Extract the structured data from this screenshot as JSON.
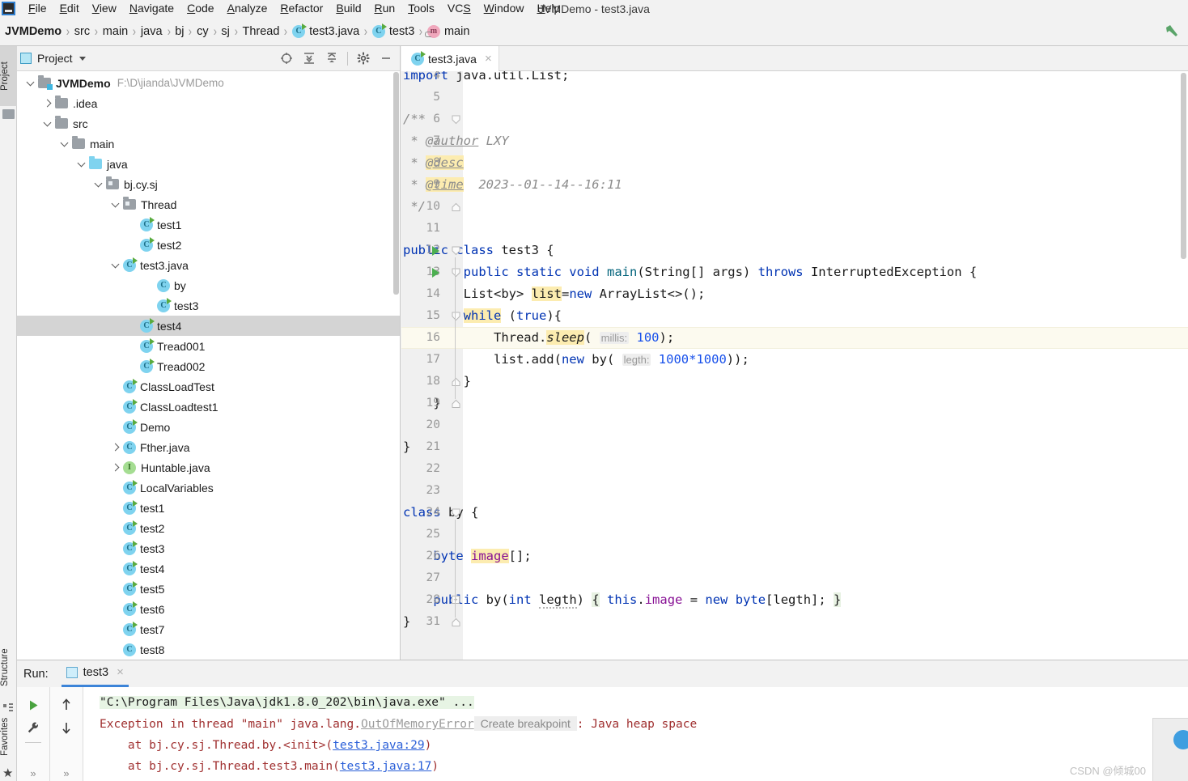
{
  "window": {
    "title": "JVMDemo - test3.java"
  },
  "menubar": {
    "logo_icon": "intellij-logo-icon",
    "items": [
      {
        "label": "File",
        "mnemonic": "F"
      },
      {
        "label": "Edit",
        "mnemonic": "E"
      },
      {
        "label": "View",
        "mnemonic": "V"
      },
      {
        "label": "Navigate",
        "mnemonic": "N"
      },
      {
        "label": "Code",
        "mnemonic": "C"
      },
      {
        "label": "Analyze",
        "mnemonic": "A"
      },
      {
        "label": "Refactor",
        "mnemonic": "R"
      },
      {
        "label": "Build",
        "mnemonic": "B"
      },
      {
        "label": "Run",
        "mnemonic": "R"
      },
      {
        "label": "Tools",
        "mnemonic": "T"
      },
      {
        "label": "VCS",
        "mnemonic": "S"
      },
      {
        "label": "Window",
        "mnemonic": "W"
      },
      {
        "label": "Help",
        "mnemonic": "H"
      }
    ]
  },
  "breadcrumb": {
    "items": [
      {
        "label": "JVMDemo",
        "icon": "none",
        "bold": true
      },
      {
        "label": "src",
        "icon": "none",
        "bold": false
      },
      {
        "label": "main",
        "icon": "none",
        "bold": false
      },
      {
        "label": "java",
        "icon": "none",
        "bold": false
      },
      {
        "label": "bj",
        "icon": "none",
        "bold": false
      },
      {
        "label": "cy",
        "icon": "none",
        "bold": false
      },
      {
        "label": "sj",
        "icon": "none",
        "bold": false
      },
      {
        "label": "Thread",
        "icon": "none",
        "bold": false
      },
      {
        "label": "test3.java",
        "icon": "class-runnable-icon",
        "bold": false
      },
      {
        "label": "test3",
        "icon": "class-runnable-icon",
        "bold": false
      },
      {
        "label": "main",
        "icon": "method-icon",
        "bold": false
      }
    ],
    "build_icon": "hammer-icon"
  },
  "left_strip": {
    "tabs": [
      {
        "label": "Project",
        "icon": "project-icon",
        "active": true
      },
      {
        "label": "Structure",
        "icon": "structure-icon",
        "active": false
      },
      {
        "label": "Favorites",
        "icon": "star-icon",
        "active": false
      }
    ]
  },
  "project_panel": {
    "title": "Project",
    "title_icon": "project-view-icon",
    "toolbar": [
      {
        "name": "select-opened-file-icon",
        "glyph": "target"
      },
      {
        "name": "expand-all-icon",
        "glyph": "expand"
      },
      {
        "name": "collapse-all-icon",
        "glyph": "collapse"
      },
      {
        "name": "settings-icon",
        "glyph": "gear"
      },
      {
        "name": "hide-icon",
        "glyph": "minus"
      }
    ],
    "tree": [
      {
        "indent": 0,
        "twisty": "down",
        "icon": "folder-module",
        "label": "JVMDemo",
        "bold": true,
        "path": "F:\\D\\jianda\\JVMDemo",
        "selected": false
      },
      {
        "indent": 1,
        "twisty": "right",
        "icon": "folder",
        "label": ".idea",
        "bold": false,
        "selected": false
      },
      {
        "indent": 1,
        "twisty": "down",
        "icon": "folder",
        "label": "src",
        "bold": false,
        "selected": false
      },
      {
        "indent": 2,
        "twisty": "down",
        "icon": "folder",
        "label": "main",
        "bold": false,
        "selected": false
      },
      {
        "indent": 3,
        "twisty": "down",
        "icon": "folder-source",
        "label": "java",
        "bold": false,
        "selected": false
      },
      {
        "indent": 4,
        "twisty": "down",
        "icon": "folder-package",
        "label": "bj.cy.sj",
        "bold": false,
        "selected": false
      },
      {
        "indent": 5,
        "twisty": "down",
        "icon": "folder-package",
        "label": "Thread",
        "bold": false,
        "selected": false
      },
      {
        "indent": 6,
        "twisty": "none",
        "icon": "class-runnable",
        "label": "test1",
        "bold": false,
        "selected": false
      },
      {
        "indent": 6,
        "twisty": "none",
        "icon": "class-runnable",
        "label": "test2",
        "bold": false,
        "selected": false
      },
      {
        "indent": 5,
        "twisty": "down",
        "icon": "class-runnable",
        "label": "test3.java",
        "bold": false,
        "selected": false
      },
      {
        "indent": 7,
        "twisty": "none",
        "icon": "class",
        "label": "by",
        "bold": false,
        "selected": false
      },
      {
        "indent": 7,
        "twisty": "none",
        "icon": "class-runnable",
        "label": "test3",
        "bold": false,
        "selected": false
      },
      {
        "indent": 6,
        "twisty": "none",
        "icon": "class-runnable",
        "label": "test4",
        "bold": false,
        "selected": true
      },
      {
        "indent": 6,
        "twisty": "none",
        "icon": "class-runnable",
        "label": "Tread001",
        "bold": false,
        "selected": false
      },
      {
        "indent": 6,
        "twisty": "none",
        "icon": "class-runnable",
        "label": "Tread002",
        "bold": false,
        "selected": false
      },
      {
        "indent": 5,
        "twisty": "none",
        "icon": "class-runnable",
        "label": "ClassLoadTest",
        "bold": false,
        "selected": false
      },
      {
        "indent": 5,
        "twisty": "none",
        "icon": "class-runnable",
        "label": "ClassLoadtest1",
        "bold": false,
        "selected": false
      },
      {
        "indent": 5,
        "twisty": "none",
        "icon": "class-runnable",
        "label": "Demo",
        "bold": false,
        "selected": false
      },
      {
        "indent": 5,
        "twisty": "right",
        "icon": "class",
        "label": "Fther.java",
        "bold": false,
        "selected": false
      },
      {
        "indent": 5,
        "twisty": "right",
        "icon": "interface",
        "label": "Huntable.java",
        "bold": false,
        "selected": false
      },
      {
        "indent": 5,
        "twisty": "none",
        "icon": "class-runnable",
        "label": "LocalVariables",
        "bold": false,
        "selected": false
      },
      {
        "indent": 5,
        "twisty": "none",
        "icon": "class-runnable",
        "label": "test1",
        "bold": false,
        "selected": false
      },
      {
        "indent": 5,
        "twisty": "none",
        "icon": "class-runnable",
        "label": "test2",
        "bold": false,
        "selected": false
      },
      {
        "indent": 5,
        "twisty": "none",
        "icon": "class-runnable",
        "label": "test3",
        "bold": false,
        "selected": false
      },
      {
        "indent": 5,
        "twisty": "none",
        "icon": "class-runnable",
        "label": "test4",
        "bold": false,
        "selected": false
      },
      {
        "indent": 5,
        "twisty": "none",
        "icon": "class-runnable",
        "label": "test5",
        "bold": false,
        "selected": false
      },
      {
        "indent": 5,
        "twisty": "none",
        "icon": "class-runnable",
        "label": "test6",
        "bold": false,
        "selected": false
      },
      {
        "indent": 5,
        "twisty": "none",
        "icon": "class-runnable",
        "label": "test7",
        "bold": false,
        "selected": false
      },
      {
        "indent": 5,
        "twisty": "none",
        "icon": "class",
        "label": "test8",
        "bold": false,
        "selected": false
      }
    ]
  },
  "editor": {
    "tab": {
      "label": "test3.java",
      "icon": "class-runnable-icon",
      "close": "×"
    },
    "caret_line": 16,
    "lines": [
      {
        "num": "4",
        "text_html": "<span class=\"kw\">import</span> java.util.List;",
        "indent": 0,
        "clipped_top": true
      },
      {
        "num": "5",
        "text_html": "",
        "indent": 0
      },
      {
        "num": "6",
        "text_html": "<span class=\"cmt\">/**</span>",
        "indent": 0,
        "fold": "top"
      },
      {
        "num": "7",
        "text_html": "<span class=\"cmt\"> * </span><span class=\"tag\">@author</span><span class=\"cmt\"> LXY</span>",
        "indent": 0
      },
      {
        "num": "8",
        "text_html": "<span class=\"cmt\"> * </span><span class=\"tag hl\">@desc</span>",
        "indent": 0
      },
      {
        "num": "9",
        "text_html": "<span class=\"cmt\"> * </span><span class=\"tag hl\">@time</span><span class=\"cmt\">  2023--01--14--16:11</span>",
        "indent": 0
      },
      {
        "num": "10",
        "text_html": "<span class=\"cmt\"> */</span>",
        "indent": 0,
        "fold": "bottom"
      },
      {
        "num": "11",
        "text_html": "",
        "indent": 0
      },
      {
        "num": "12",
        "text_html": "<span class=\"kw\">public class</span> test3 {",
        "indent": 0,
        "run": true,
        "fold": "top"
      },
      {
        "num": "13",
        "text_html": "        <span class=\"kw\">public static void</span> <span style=\"color:#00627a\">main</span>(String[] args) <span class=\"kw\">throws</span> InterruptedException {",
        "indent": 0,
        "run": true,
        "fold": "topsmall"
      },
      {
        "num": "14",
        "text_html": "        List&lt;by&gt; <span class=\"hl\">list</span>=<span class=\"kw\">new</span> ArrayList&lt;&gt;();",
        "indent": 0
      },
      {
        "num": "15",
        "text_html": "        <span class=\"kw hl\">while</span> (<span class=\"kw\">true</span>){",
        "indent": 0,
        "fold": "topsmall"
      },
      {
        "num": "16",
        "text_html": "            Thread.<span class=\"itc hl\">sleep</span>( <span class=\"hint\">millis:</span> <span class=\"num\">100</span>);",
        "indent": 0
      },
      {
        "num": "17",
        "text_html": "            list.add(<span class=\"kw\">new</span> by( <span class=\"hint\">legth:</span> <span class=\"num\">1000*1000</span>));",
        "indent": 0
      },
      {
        "num": "18",
        "text_html": "        }",
        "indent": 0,
        "fold": "bottom"
      },
      {
        "num": "19",
        "text_html": "    }",
        "indent": 0,
        "fold": "bottom"
      },
      {
        "num": "20",
        "text_html": "",
        "indent": 0
      },
      {
        "num": "21",
        "text_html": "}",
        "indent": 0
      },
      {
        "num": "22",
        "text_html": "",
        "indent": 0
      },
      {
        "num": "23",
        "text_html": "",
        "indent": 0
      },
      {
        "num": "24",
        "text_html": "<span class=\"kw\">class</span> by {",
        "indent": 0,
        "fold": "top"
      },
      {
        "num": "25",
        "text_html": "",
        "indent": 0
      },
      {
        "num": "26",
        "text_html": "    <span class=\"kw\">byte</span> <span class=\"fld hl\">image</span>[];",
        "indent": 0
      },
      {
        "num": "27",
        "text_html": "",
        "indent": 0
      },
      {
        "num": "28",
        "text_html": "    <span class=\"kw\">public</span> by(<span class=\"kw\">int</span> <span class=\"squig\">legth</span>) <span class=\"hl2\">{</span> <span class=\"kw\">this</span>.<span class=\"fld\">image</span> = <span class=\"kw\">new</span> <span class=\"kw\">byte</span>[legth]; <span class=\"hl2\">}</span>",
        "indent": 0,
        "fold": "plus"
      },
      {
        "num": "31",
        "text_html": "}",
        "indent": 0,
        "fold": "bottom"
      }
    ]
  },
  "run_panel": {
    "label": "Run:",
    "tab": {
      "label": "test3",
      "icon": "run-config-icon",
      "close": "×"
    },
    "gutter_icons": [
      {
        "name": "rerun-icon",
        "glyph": "play"
      },
      {
        "name": "settings-wrench-icon",
        "glyph": "wrench"
      },
      {
        "name": "more-icon",
        "glyph": "»"
      }
    ],
    "gutter_icons2": [
      {
        "name": "up-arrow-icon",
        "glyph": "↑"
      },
      {
        "name": "down-arrow-icon",
        "glyph": "↓"
      },
      {
        "name": "more-icon",
        "glyph": "»"
      }
    ],
    "console": {
      "command": "\"C:\\Program Files\\Java\\jdk1.8.0_202\\bin\\java.exe\" ...",
      "exception_prefix": "Exception in thread \"main\" java.lang.",
      "exception_class": "OutOfMemoryError",
      "breakpoint_hint": "Create breakpoint",
      "exception_suffix": ": Java heap space",
      "stack": [
        {
          "prefix": "    at bj.cy.sj.Thread.by.<init>(",
          "link": "test3.java:29",
          "suffix": ")"
        },
        {
          "prefix": "    at bj.cy.sj.Thread.test3.main(",
          "link": "test3.java:17",
          "suffix": ")"
        }
      ]
    }
  },
  "watermark": {
    "text": "CSDN @倾城00"
  },
  "colors": {
    "accent_blue": "#3c84d8",
    "keyword_blue": "#0033b3",
    "error_red": "#a03030",
    "link_blue": "#2a5fd8",
    "highlight_yellow": "#fcecb0",
    "selection_gray": "#d4d4d4",
    "run_green": "#4caf50"
  }
}
